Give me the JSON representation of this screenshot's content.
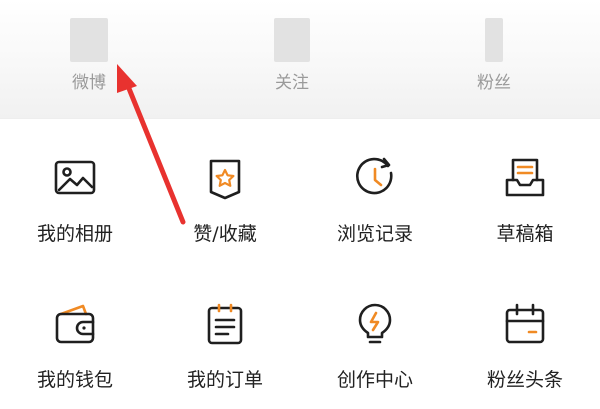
{
  "stats": {
    "weibo": "微博",
    "follow": "关注",
    "fans": "粉丝"
  },
  "menu": {
    "row1": [
      {
        "label": "我的相册",
        "icon": "photo-album-icon"
      },
      {
        "label": "赞/收藏",
        "icon": "favorite-badge-icon"
      },
      {
        "label": "浏览记录",
        "icon": "history-clock-icon"
      },
      {
        "label": "草稿箱",
        "icon": "drafts-tray-icon"
      }
    ],
    "row2": [
      {
        "label": "我的钱包",
        "icon": "wallet-icon"
      },
      {
        "label": "我的订单",
        "icon": "order-list-icon"
      },
      {
        "label": "创作中心",
        "icon": "creator-bulb-icon"
      },
      {
        "label": "粉丝头条",
        "icon": "fans-headline-calendar-icon"
      }
    ]
  },
  "colors": {
    "icon_stroke": "#1f1f1f",
    "icon_accent": "#f08a24",
    "annotation_arrow": "#e8322f",
    "stat_label": "#9a9a9a"
  }
}
